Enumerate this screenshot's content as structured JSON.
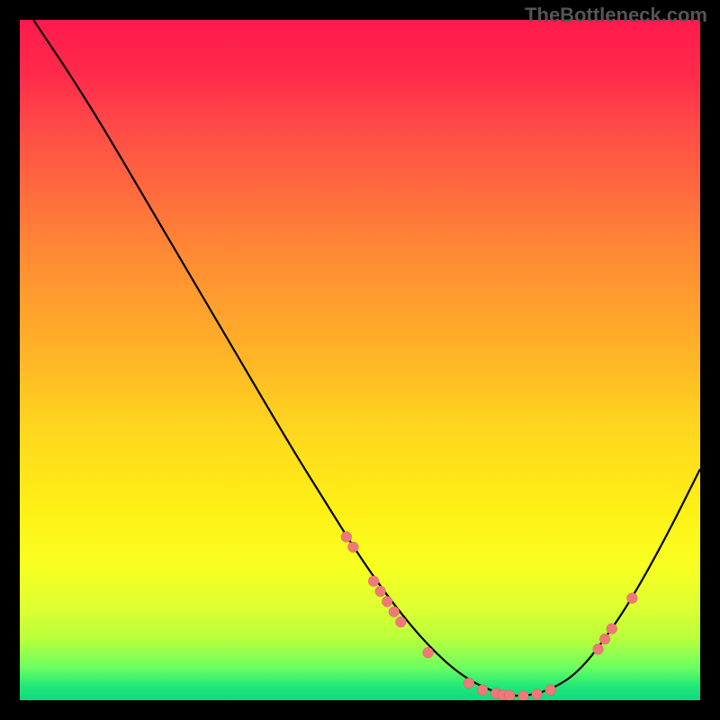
{
  "watermark": "TheBottleneck.com",
  "chart_data": {
    "type": "line",
    "title": "",
    "xlabel": "",
    "ylabel": "",
    "xlim": [
      0,
      100
    ],
    "ylim": [
      0,
      100
    ],
    "grid": false,
    "curve_xy": [
      [
        2,
        100
      ],
      [
        10,
        88
      ],
      [
        20,
        71
      ],
      [
        30,
        54
      ],
      [
        40,
        37
      ],
      [
        45,
        29
      ],
      [
        50,
        21
      ],
      [
        55,
        14
      ],
      [
        60,
        8
      ],
      [
        65,
        3.5
      ],
      [
        70,
        1
      ],
      [
        74,
        0.5
      ],
      [
        78,
        1.5
      ],
      [
        82,
        4
      ],
      [
        86,
        9
      ],
      [
        90,
        15
      ],
      [
        95,
        24
      ],
      [
        100,
        34
      ]
    ],
    "points_xy": [
      [
        48,
        24
      ],
      [
        49,
        22.5
      ],
      [
        52,
        17.5
      ],
      [
        53,
        16
      ],
      [
        54,
        14.5
      ],
      [
        55,
        13
      ],
      [
        56,
        11.5
      ],
      [
        60,
        7
      ],
      [
        66,
        2.5
      ],
      [
        68,
        1.5
      ],
      [
        70,
        1
      ],
      [
        71,
        0.8
      ],
      [
        72,
        0.7
      ],
      [
        74,
        0.6
      ],
      [
        76,
        0.9
      ],
      [
        78,
        1.5
      ],
      [
        85,
        7.5
      ],
      [
        86,
        9
      ],
      [
        87,
        10.5
      ],
      [
        90,
        15
      ]
    ],
    "note": "Axis values are plotting percentages (0-100 both axes); chart carries no explicit tick labels."
  }
}
